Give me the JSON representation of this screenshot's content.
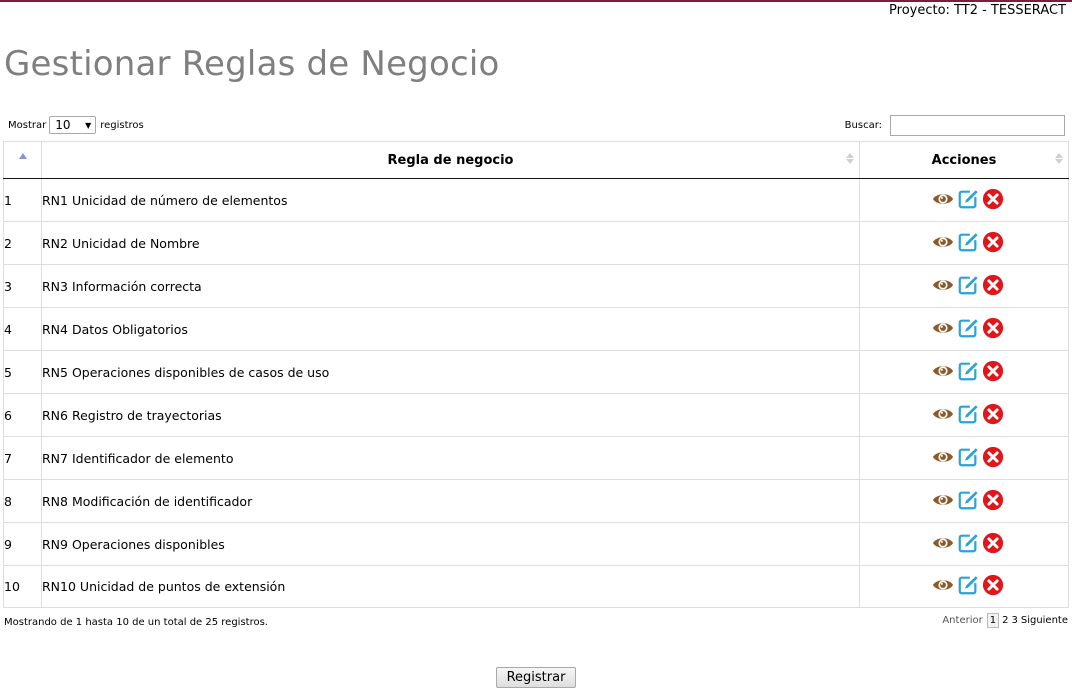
{
  "header": {
    "project": "Proyecto: TT2 - TESSERACT"
  },
  "page": {
    "title": "Gestionar Reglas de Negocio"
  },
  "controls": {
    "show_label": "Mostrar",
    "page_size": "10",
    "records_label": "registros",
    "search_label": "Buscar:",
    "search_value": ""
  },
  "table": {
    "columns": [
      "",
      "Regla de negocio",
      "Acciones"
    ],
    "rows": [
      {
        "num": "1",
        "rule": "RN1 Unicidad de número de elementos"
      },
      {
        "num": "2",
        "rule": "RN2 Unicidad de Nombre"
      },
      {
        "num": "3",
        "rule": "RN3 Información correcta"
      },
      {
        "num": "4",
        "rule": "RN4 Datos Obligatorios"
      },
      {
        "num": "5",
        "rule": "RN5 Operaciones disponibles de casos de uso"
      },
      {
        "num": "6",
        "rule": "RN6 Registro de trayectorias"
      },
      {
        "num": "7",
        "rule": "RN7 Identificador de elemento"
      },
      {
        "num": "8",
        "rule": "RN8 Modificación de identificador"
      },
      {
        "num": "9",
        "rule": "RN9 Operaciones disponibles"
      },
      {
        "num": "10",
        "rule": "RN10 Unicidad de puntos de extensión"
      }
    ],
    "action_icons": [
      "eye-icon",
      "edit-icon",
      "delete-icon"
    ]
  },
  "footer": {
    "info": "Mostrando de 1 hasta 10 de un total de 25 registros.",
    "prev": "Anterior",
    "pages": [
      "1",
      "2",
      "3"
    ],
    "next": "Siguiente"
  },
  "actions": {
    "register": "Registrar"
  },
  "colors": {
    "accent_line": "#7b1d3f",
    "title": "#7f7f7f",
    "eye": "#8b5a2b",
    "edit": "#2aa3d6",
    "delete": "#e0161b"
  }
}
